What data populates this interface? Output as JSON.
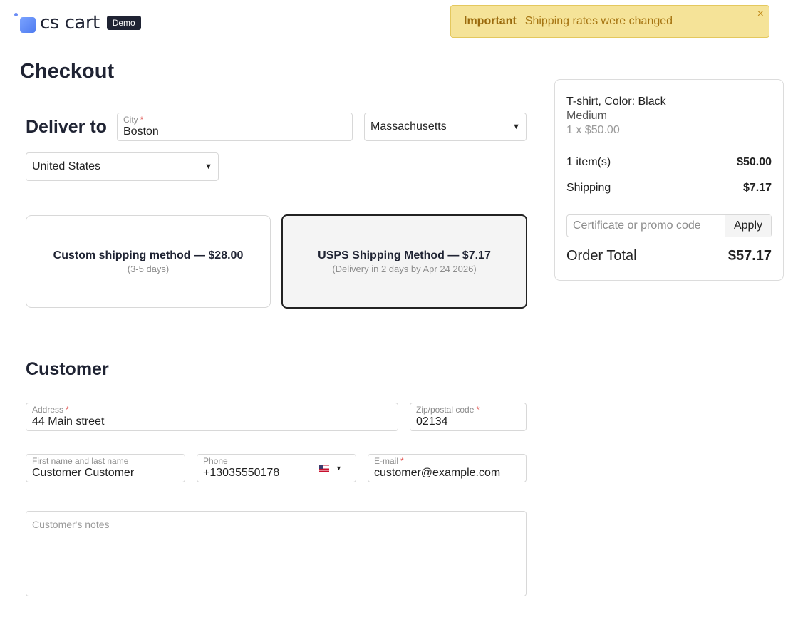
{
  "header": {
    "logo_text": "cs cart",
    "badge": "Demo"
  },
  "notice": {
    "title": "Important",
    "text": "Shipping rates were changed",
    "close": "×"
  },
  "page_title": "Checkout",
  "deliver": {
    "heading": "Deliver to",
    "city": {
      "label": "City",
      "required": "*",
      "value": "Boston"
    },
    "state": {
      "value": "Massachusetts"
    },
    "country": {
      "value": "United States"
    }
  },
  "shipping_methods": [
    {
      "title": "Custom shipping method — $28.00",
      "subtitle": "(3-5 days)",
      "selected": false
    },
    {
      "title": "USPS Shipping Method — $7.17",
      "subtitle": "(Delivery in 2 days by Apr 24 2026)",
      "selected": true
    }
  ],
  "customer": {
    "heading": "Customer",
    "address": {
      "label": "Address",
      "required": "*",
      "value": "44 Main street"
    },
    "zip": {
      "label": "Zip/postal code",
      "required": "*",
      "value": "02134"
    },
    "name": {
      "label": "First name and last name",
      "value": "Customer Customer"
    },
    "phone": {
      "label": "Phone",
      "value": "+13035550178",
      "country_flag": "us-flag-icon"
    },
    "email": {
      "label": "E-mail",
      "required": "*",
      "value": "customer@example.com"
    },
    "notes": {
      "placeholder": "Customer's notes"
    }
  },
  "summary": {
    "item_title": "T-shirt, Color: Black",
    "item_variant": "Medium",
    "item_price": "1 x $50.00",
    "items_label": "1 item(s)",
    "items_value": "$50.00",
    "shipping_label": "Shipping",
    "shipping_value": "$7.17",
    "promo_placeholder": "Certificate or promo code",
    "promo_button": "Apply",
    "total_label": "Order Total",
    "total_value": "$57.17"
  },
  "colors": {
    "notice_bg": "#f5e398",
    "notice_text": "#a67512",
    "required": "#e0524f",
    "dark": "#1f2333"
  }
}
